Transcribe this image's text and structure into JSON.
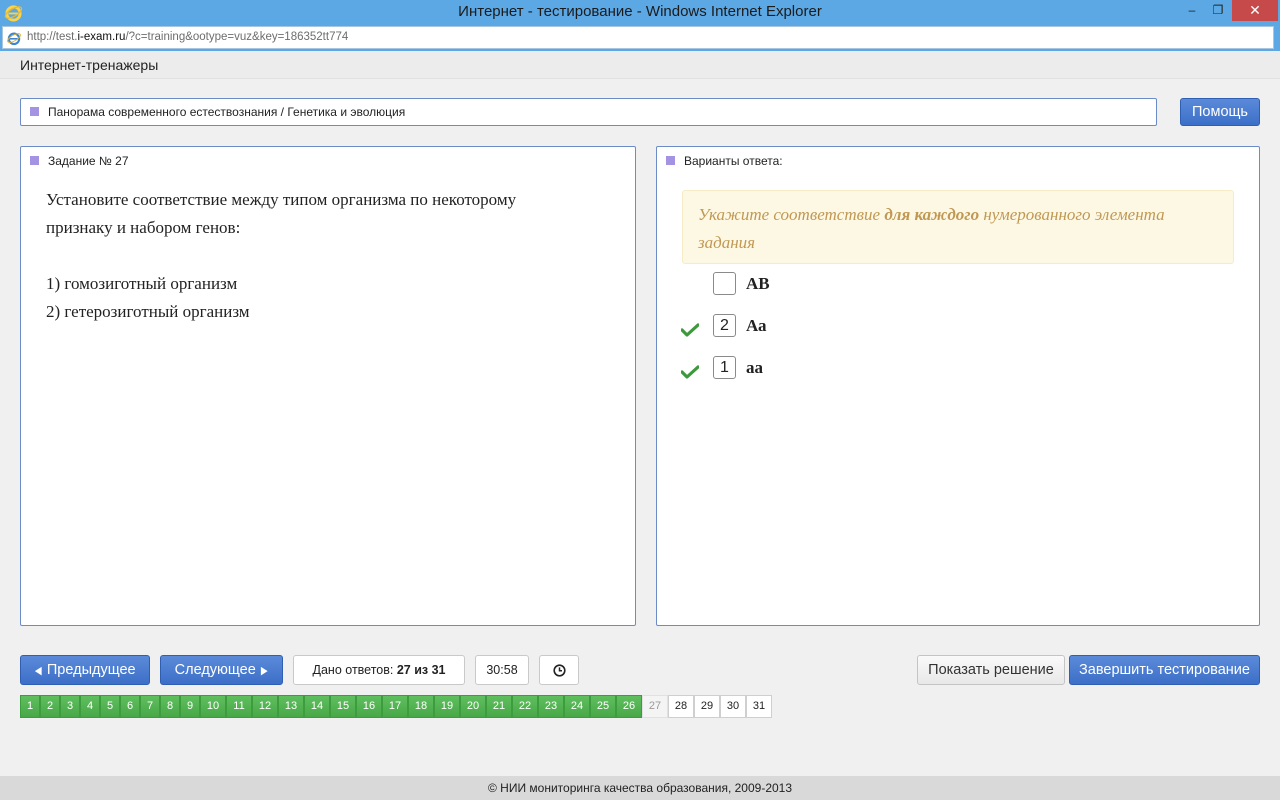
{
  "window": {
    "title": "Интернет - тестирование - Windows Internet Explorer",
    "min_glyph": "‒",
    "max_glyph": "❐",
    "close_glyph": "✕"
  },
  "address": {
    "url_prefix": "http://test.",
    "url_host": "i-exam.ru",
    "url_rest": "/?c=training&ootype=vuz&key=186352tt774"
  },
  "header": {
    "brand": "Интернет-тренажеры"
  },
  "breadcrumb": {
    "text": "Панорама современного естествознания / Генетика и эволюция"
  },
  "help_label": "Помощь",
  "task": {
    "title": "Задание № 27",
    "prompt_line1": "Установите соответствие между типом организма по некоторому",
    "prompt_line2": "признаку и набором генов:",
    "items": [
      "1) гомозиготный организм",
      "2) гетерозиготный организм"
    ]
  },
  "answers_panel": {
    "title": "Варианты ответа:",
    "hint_before": "Укажите соответствие ",
    "hint_bold": "для каждого",
    "hint_after": " нумерованного элемента задания",
    "options": [
      {
        "value": "",
        "label": "АВ",
        "checked": false
      },
      {
        "value": "2",
        "label": "Аа",
        "checked": true
      },
      {
        "value": "1",
        "label": "аа",
        "checked": true
      }
    ]
  },
  "nav": {
    "prev_label": "Предыдущее",
    "next_label": "Следующее",
    "answered_prefix": "Дано ответов: ",
    "answered_value": "27 из 31",
    "timer": "30:58",
    "show_solution": "Показать решение",
    "finish": "Завершить тестирование"
  },
  "pagination": {
    "pages": [
      "1",
      "2",
      "3",
      "4",
      "5",
      "6",
      "7",
      "8",
      "9",
      "10",
      "11",
      "12",
      "13",
      "14",
      "15",
      "16",
      "17",
      "18",
      "19",
      "20",
      "21",
      "22",
      "23",
      "24",
      "25",
      "26",
      "27",
      "28",
      "29",
      "30",
      "31"
    ],
    "answered_through": 26,
    "current": 27
  },
  "footer": {
    "text": "© НИИ мониторинга качества образования, 2009-2013"
  },
  "colors": {
    "accent_blue": "#3c6fc8",
    "answered_green": "#48a848",
    "hint_text": "#c09853",
    "marker_purple": "#a493e3"
  }
}
